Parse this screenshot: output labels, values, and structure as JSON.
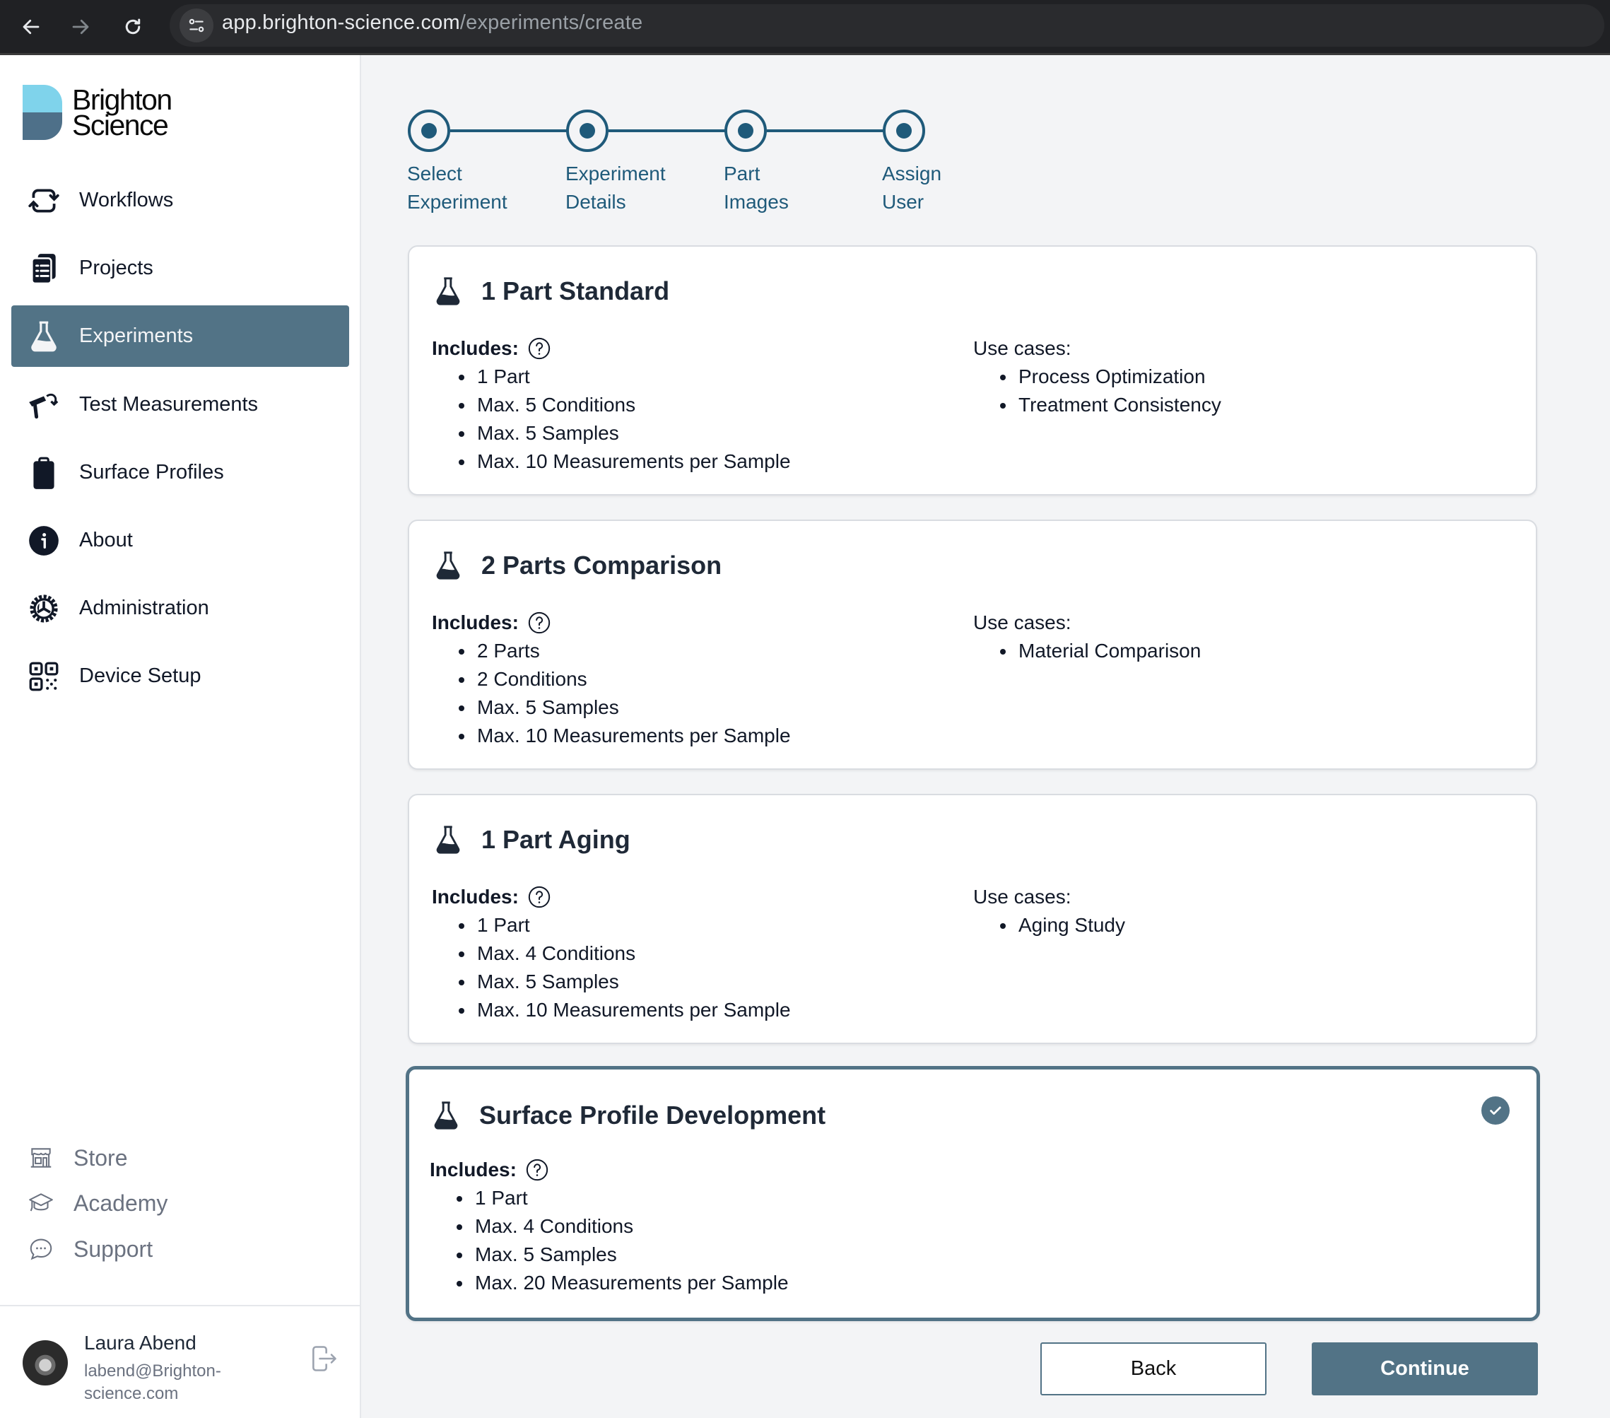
{
  "browser": {
    "url_host": "app.brighton-science.com",
    "url_path": "/experiments/create"
  },
  "sidebar": {
    "brand": {
      "line1": "Brighton",
      "line2": "Science",
      "colors": {
        "top": "#7fd3eb",
        "bottom": "#4e7089"
      }
    },
    "items": [
      {
        "label": "Workflows",
        "icon": "workflow-cycle-icon",
        "active": false
      },
      {
        "label": "Projects",
        "icon": "clipboard-list-icon",
        "active": false
      },
      {
        "label": "Experiments",
        "icon": "flask-icon",
        "active": true
      },
      {
        "label": "Test Measurements",
        "icon": "measurement-device-icon",
        "active": false
      },
      {
        "label": "Surface Profiles",
        "icon": "clipboard-icon",
        "active": false
      },
      {
        "label": "About",
        "icon": "info-icon",
        "active": false
      },
      {
        "label": "Administration",
        "icon": "gear-icon",
        "active": false
      },
      {
        "label": "Device Setup",
        "icon": "qr-code-icon",
        "active": false
      }
    ],
    "secondary": [
      {
        "label": "Store",
        "icon": "store-icon"
      },
      {
        "label": "Academy",
        "icon": "graduation-cap-icon"
      },
      {
        "label": "Support",
        "icon": "chat-bubble-icon"
      }
    ],
    "user": {
      "name": "Laura Abend",
      "email": "labend@Brighton-science.com"
    }
  },
  "stepper": {
    "steps": [
      {
        "line1": "Select",
        "line2": "Experiment"
      },
      {
        "line1": "Experiment",
        "line2": "Details"
      },
      {
        "line1": "Part",
        "line2": "Images"
      },
      {
        "line1": "Assign",
        "line2": "User"
      }
    ]
  },
  "experiments": [
    {
      "title": "1 Part Standard",
      "includes_label": "Includes:",
      "includes": [
        "1 Part",
        "Max. 5 Conditions",
        "Max. 5 Samples",
        "Max. 10 Measurements per Sample"
      ],
      "usecases_label": "Use cases:",
      "usecases": [
        "Process Optimization",
        "Treatment Consistency"
      ],
      "selected": false
    },
    {
      "title": "2 Parts Comparison",
      "includes_label": "Includes:",
      "includes": [
        "2 Parts",
        "2 Conditions",
        "Max. 5 Samples",
        "Max. 10 Measurements per Sample"
      ],
      "usecases_label": "Use cases:",
      "usecases": [
        "Material Comparison"
      ],
      "selected": false
    },
    {
      "title": "1 Part Aging",
      "includes_label": "Includes:",
      "includes": [
        "1 Part",
        "Max. 4 Conditions",
        "Max. 5 Samples",
        "Max. 10 Measurements per Sample"
      ],
      "usecases_label": "Use cases:",
      "usecases": [
        "Aging Study"
      ],
      "selected": false
    },
    {
      "title": "Surface Profile Development",
      "includes_label": "Includes:",
      "includes": [
        "1 Part",
        "Max. 4 Conditions",
        "Max. 5 Samples",
        "Max. 20 Measurements per Sample"
      ],
      "selected": true
    }
  ],
  "actions": {
    "back_label": "Back",
    "continue_label": "Continue"
  },
  "theme": {
    "accent": "#527386",
    "stepper": "#1f5a7a",
    "text": "#111827",
    "muted": "#6b7280",
    "background": "#f3f4f6"
  }
}
